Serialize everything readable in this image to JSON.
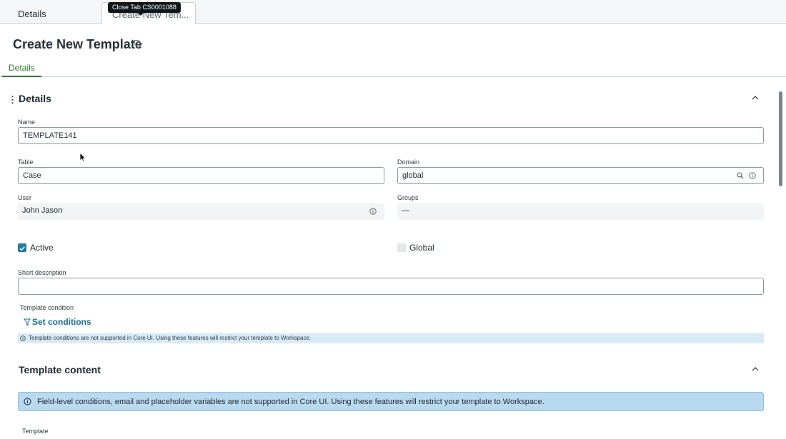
{
  "tabs": {
    "details": "Details",
    "active": "Create New Tem...",
    "tooltip": "Close Tab CS0001088"
  },
  "page": {
    "title": "Create New Template",
    "title_icon": "tag-icon"
  },
  "subtabs": {
    "details": "Details"
  },
  "details_section": {
    "title": "Details",
    "name_label": "Name",
    "name_value": "TEMPLATE141",
    "table_label": "Table",
    "table_value": "Case",
    "domain_label": "Domain",
    "domain_value": "global",
    "user_label": "User",
    "user_value": "John Jason",
    "groups_label": "Groups",
    "groups_value": "—",
    "active_label": "Active",
    "active_checked": true,
    "global_label": "Global",
    "global_checked": false,
    "short_description_label": "Short description",
    "short_description_value": "",
    "template_condition_label": "Template condition",
    "set_conditions": "Set conditions",
    "condition_note": "Template conditions are not supported in Core UI. Using these features will restrict your template to Workspace."
  },
  "content_section": {
    "title": "Template content",
    "note": "Field-level conditions, email and placeholder variables are not supported in Core UI. Using these features will restrict your template to Workspace.",
    "template_label": "Template"
  },
  "colors": {
    "accent_green": "#2e7d32",
    "checkbox_blue": "#1f7e9c",
    "link_blue": "#1a6f8d",
    "note_bg": "#b9d9ef"
  }
}
